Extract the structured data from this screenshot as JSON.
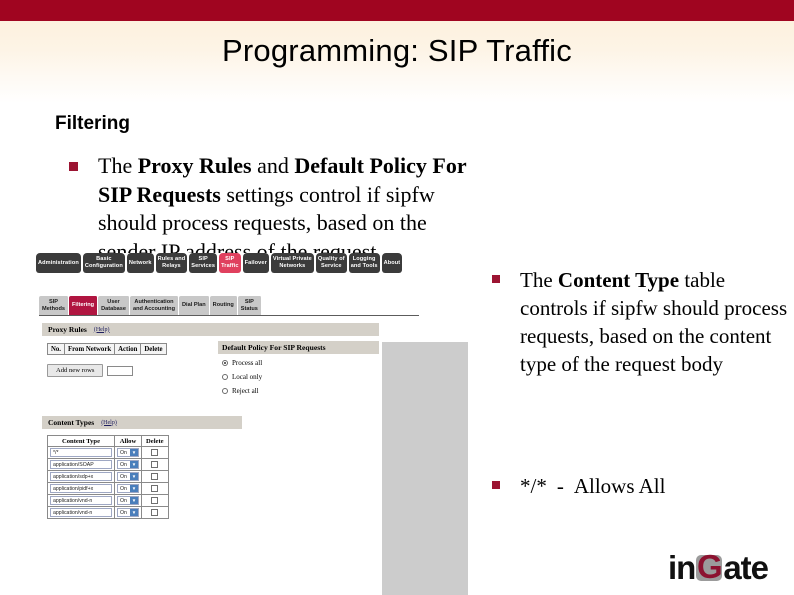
{
  "slide": {
    "title": "Programming: SIP Traffic",
    "section_heading": "Filtering",
    "accent_bar_color": "#a00520",
    "bullet_color": "#9c1432"
  },
  "bullets": {
    "left": {
      "part1": "The ",
      "bold1": "Proxy Rules",
      "part2": " and ",
      "bold2": "Default Policy For SIP Requests",
      "part3": " settings control if sipfw should process requests, based on the sender IP address of the request"
    },
    "right_1": {
      "part1": "The ",
      "bold1": "Content Type",
      "part2": " table controls if sipfw should process requests, based on the content type of the request body"
    },
    "right_2": {
      "pattern": "*/*",
      "dash": "-",
      "description": "Allows All"
    }
  },
  "app": {
    "main_tabs": [
      {
        "label": "Administration",
        "active": false
      },
      {
        "label": "Basic\nConfiguration",
        "active": false
      },
      {
        "label": "Network",
        "active": false
      },
      {
        "label": "Rules and\nRelays",
        "active": false
      },
      {
        "label": "SIP\nServices",
        "active": false
      },
      {
        "label": "SIP\nTraffic",
        "active": true
      },
      {
        "label": "Failover",
        "active": false
      },
      {
        "label": "Virtual Private\nNetworks",
        "active": false
      },
      {
        "label": "Quality of\nService",
        "active": false
      },
      {
        "label": "Logging\nand Tools",
        "active": false
      },
      {
        "label": "About",
        "active": false
      }
    ],
    "sub_tabs": [
      {
        "label": "SIP\nMethods",
        "active": false
      },
      {
        "label": "Filtering",
        "active": true
      },
      {
        "label": "User\nDatabase",
        "active": false
      },
      {
        "label": "Authentication\nand Accounting",
        "active": false
      },
      {
        "label": "Dial Plan",
        "active": false
      },
      {
        "label": "Routing",
        "active": false
      },
      {
        "label": "SIP\nStatus",
        "active": false
      }
    ],
    "proxy_rules": {
      "title": "Proxy Rules",
      "help": "(Help)",
      "columns": [
        "No.",
        "From Network",
        "Action",
        "Delete"
      ],
      "add_button": "Add new rows",
      "add_input_value": ""
    },
    "default_policy": {
      "title": "Default Policy For SIP Requests",
      "options": [
        {
          "label": "Process all",
          "selected": true
        },
        {
          "label": "Local only",
          "selected": false
        },
        {
          "label": "Reject all",
          "selected": false
        }
      ]
    },
    "content_types": {
      "title": "Content Types",
      "help": "(Help)",
      "columns": [
        "Content Type",
        "Allow",
        "Delete"
      ],
      "rows": [
        {
          "type": "*/*",
          "allow": "On",
          "delete": false
        },
        {
          "type": "application/SOAP",
          "allow": "On",
          "delete": false
        },
        {
          "type": "application/sdp+x",
          "allow": "On",
          "delete": false
        },
        {
          "type": "application/pidf+x",
          "allow": "On",
          "delete": false
        },
        {
          "type": "application/vnd-n",
          "allow": "On",
          "delete": false
        },
        {
          "type": "application/vnd-n",
          "allow": "On",
          "delete": false
        }
      ]
    }
  },
  "logo": {
    "prefix": "in",
    "middle": "G",
    "suffix": "ate"
  }
}
